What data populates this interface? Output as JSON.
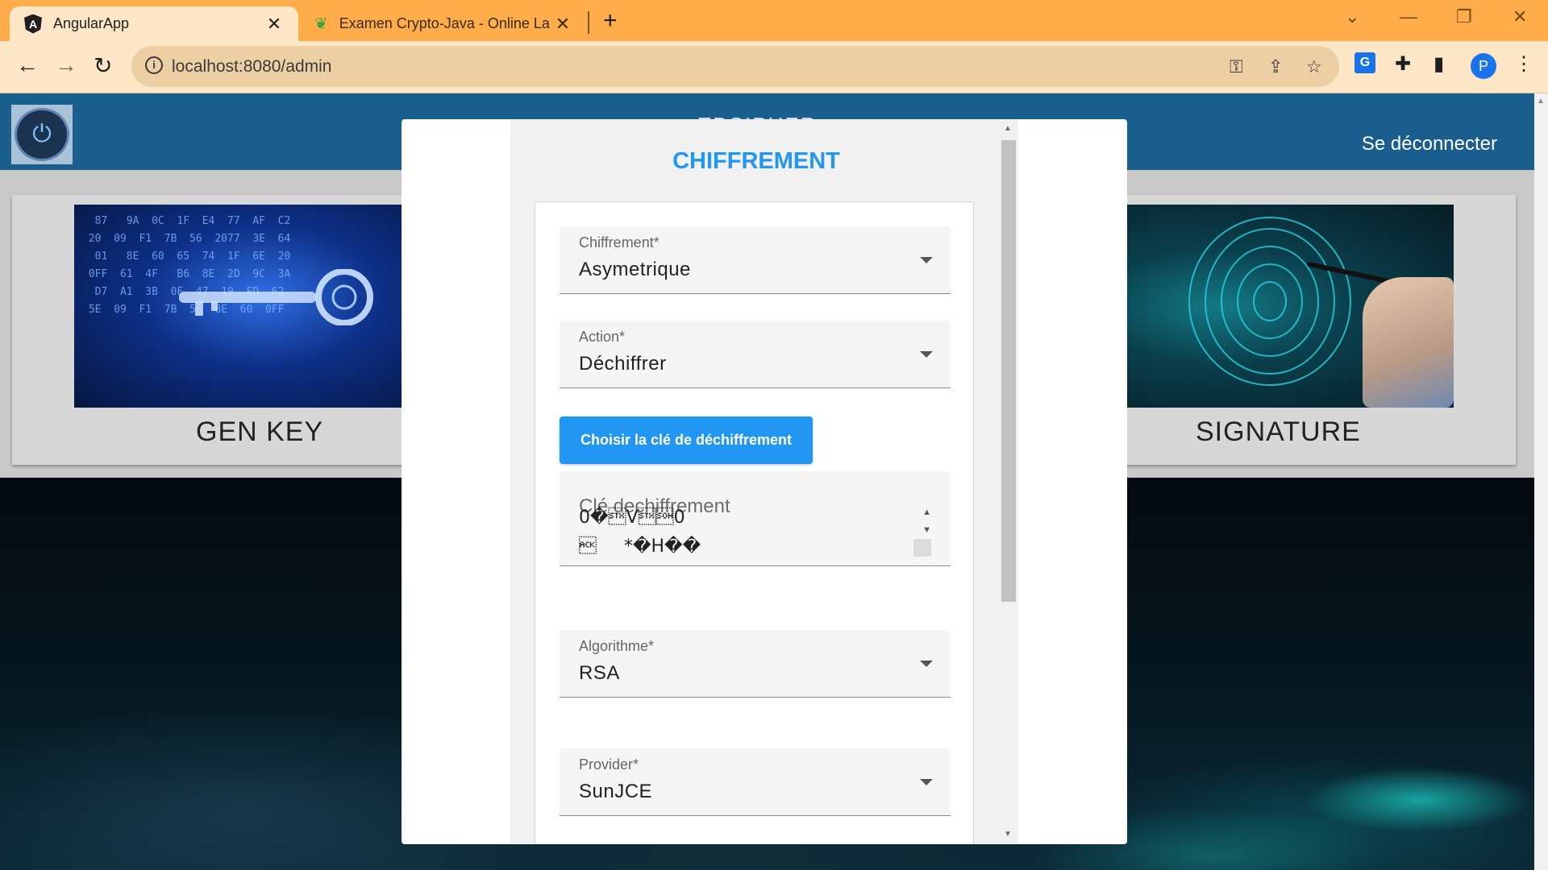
{
  "browser": {
    "tabs": [
      {
        "title": "AngularApp",
        "active": true,
        "icon": "angular-icon"
      },
      {
        "title": "Examen Crypto-Java - Online La",
        "active": false,
        "icon": "leaf-icon"
      }
    ],
    "url": "localhost:8080/admin",
    "profile_initial": "P"
  },
  "navbar": {
    "brand": "TPCIPHER",
    "logout": "Se déconnecter"
  },
  "cards": [
    {
      "label": "GEN KEY"
    },
    {
      "label": "SIGNATURE"
    }
  ],
  "modal": {
    "title": "CHIFFREMENT",
    "fields": {
      "chiffrement": {
        "label": "Chiffrement*",
        "value": "Asymetrique"
      },
      "action": {
        "label": "Action*",
        "value": "Déchiffrer"
      },
      "algorithme": {
        "label": "Algorithme*",
        "value": "RSA"
      },
      "provider": {
        "label": "Provider*",
        "value": "SunJCE"
      }
    },
    "choose_key_button": "Choisir la clé de déchiffrement",
    "key_textarea": {
      "label": "Clé dechiffrement",
      "value": "0�\u0002V\u0002\u00010\n\u0006\t*�H��"
    }
  },
  "colors": {
    "accent": "#2196f3",
    "navbar": "#1a5e8e",
    "tabstrip": "#ffad4a"
  }
}
